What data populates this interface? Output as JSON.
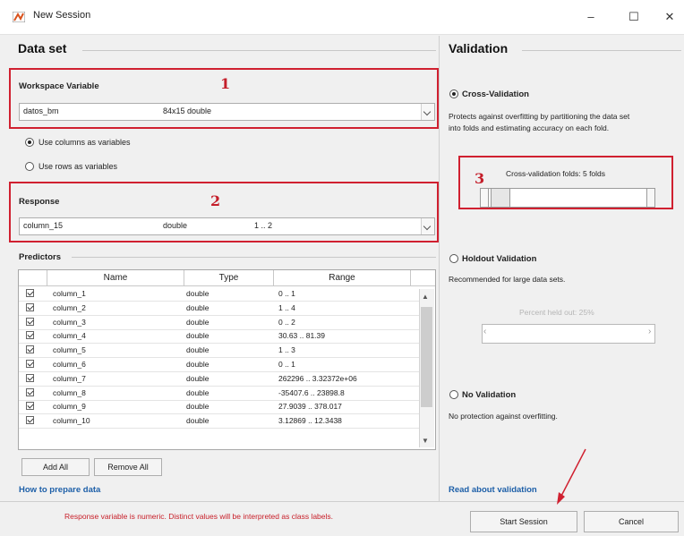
{
  "window": {
    "title": "New Session",
    "minimize": "–",
    "maximize": "☐",
    "close": "✕"
  },
  "dataset": {
    "title": "Data set",
    "workspace_label": "Workspace Variable",
    "workspace_var": {
      "name": "datos_bm",
      "info": "84x15 double"
    },
    "use_columns": "Use columns as variables",
    "use_rows": "Use rows as variables",
    "response_label": "Response",
    "response": {
      "name": "column_15",
      "type": "double",
      "range": "1 .. 2"
    },
    "predictors_label": "Predictors",
    "columns": {
      "name": "Name",
      "type": "Type",
      "range": "Range"
    },
    "rows": [
      {
        "name": "column_1",
        "type": "double",
        "range": "0 .. 1"
      },
      {
        "name": "column_2",
        "type": "double",
        "range": "1 .. 4"
      },
      {
        "name": "column_3",
        "type": "double",
        "range": "0 .. 2"
      },
      {
        "name": "column_4",
        "type": "double",
        "range": "30.63 .. 81.39"
      },
      {
        "name": "column_5",
        "type": "double",
        "range": "1 .. 3"
      },
      {
        "name": "column_6",
        "type": "double",
        "range": "0 .. 1"
      },
      {
        "name": "column_7",
        "type": "double",
        "range": "262296 .. 3.32372e+06"
      },
      {
        "name": "column_8",
        "type": "double",
        "range": "-35407.6 .. 23898.8"
      },
      {
        "name": "column_9",
        "type": "double",
        "range": "27.9039 .. 378.017"
      },
      {
        "name": "column_10",
        "type": "double",
        "range": "3.12869 .. 12.3438"
      }
    ],
    "add_all": "Add All",
    "remove_all": "Remove All",
    "how_to": "How to prepare data",
    "status": "Response variable is numeric. Distinct values will be interpreted as class labels."
  },
  "annotations": {
    "one": "1",
    "two": "2",
    "three": "3"
  },
  "validation": {
    "title": "Validation",
    "cross_label": "Cross-Validation",
    "cross_desc_1": "Protects against overfitting by partitioning the data set",
    "cross_desc_2": "into folds and estimating accuracy on each fold.",
    "folds_text": "Cross-validation folds: 5 folds",
    "holdout_label": "Holdout Validation",
    "holdout_desc": "Recommended for large data sets.",
    "holdout_percent": "Percent held out: 25%",
    "no_label": "No Validation",
    "no_desc": "No protection against overfitting.",
    "read_about": "Read about validation"
  },
  "buttons": {
    "start": "Start Session",
    "cancel": "Cancel"
  },
  "colors": {
    "annotation_red": "#d02030",
    "link_blue": "#1d5fa8",
    "status_red": "#c8202a"
  }
}
